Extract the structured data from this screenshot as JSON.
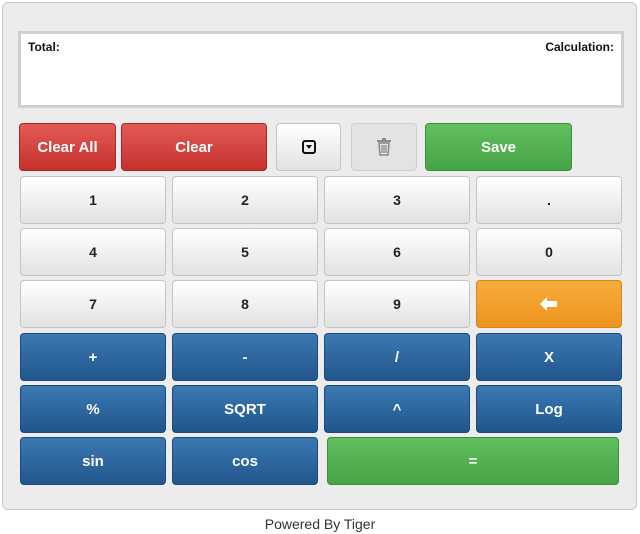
{
  "display": {
    "total_label": "Total:",
    "calculation_label": "Calculation:"
  },
  "toolbar": {
    "clear_all": "Clear All",
    "clear": "Clear",
    "save": "Save"
  },
  "keys": {
    "k1": "1",
    "k2": "2",
    "k3": "3",
    "dot": ".",
    "k4": "4",
    "k5": "5",
    "k6": "6",
    "k0": "0",
    "k7": "7",
    "k8": "8",
    "k9": "9",
    "plus": "+",
    "minus": "-",
    "divide": "/",
    "multiply": "X",
    "percent": "%",
    "sqrt": "SQRT",
    "power": "^",
    "log": "Log",
    "sin": "sin",
    "cos": "cos",
    "equals": "="
  },
  "icons": {
    "history": "dropdown-box-icon",
    "trash": "trash-icon",
    "backspace": "arrow-left-icon"
  },
  "footer": {
    "text": "Powered By Tiger"
  },
  "colors": {
    "red": "#d9534f",
    "green": "#5cb85c",
    "blue": "#2a6496",
    "orange": "#f0a030"
  }
}
